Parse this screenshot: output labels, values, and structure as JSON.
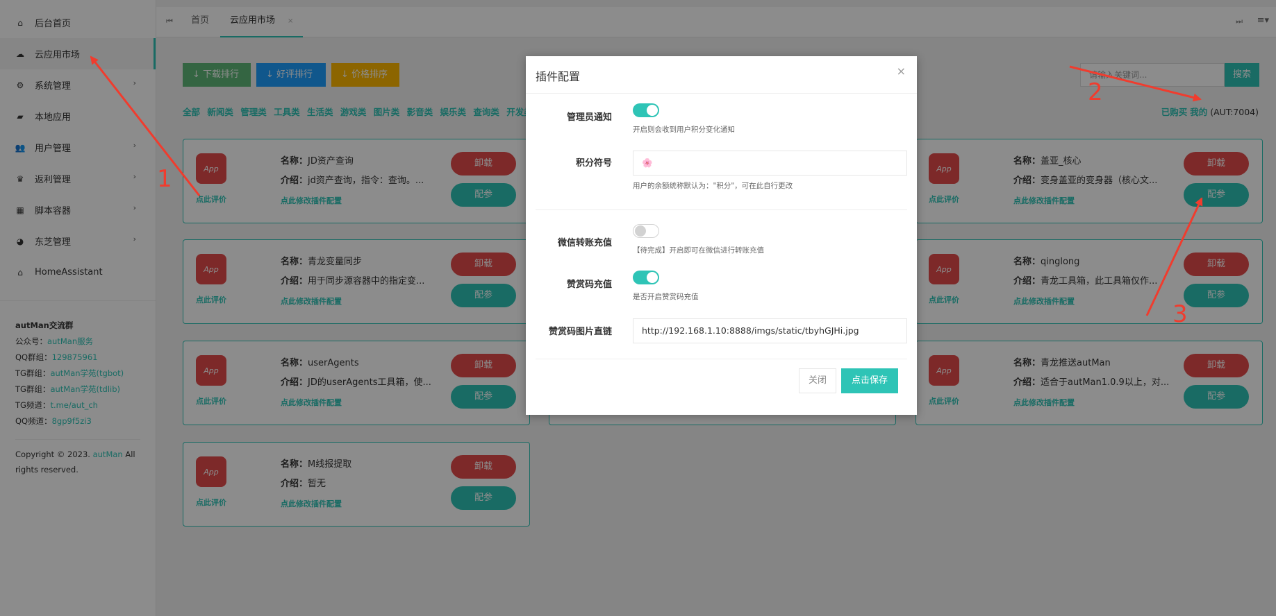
{
  "sidebar": {
    "items": [
      {
        "label": "后台首页",
        "icon": "home-icon",
        "active": false,
        "has_children": false
      },
      {
        "label": "云应用市场",
        "icon": "cloud-download-icon",
        "active": true,
        "has_children": false
      },
      {
        "label": "系统管理",
        "icon": "gear-icon",
        "active": false,
        "has_children": true
      },
      {
        "label": "本地应用",
        "icon": "cards-icon",
        "active": false,
        "has_children": false
      },
      {
        "label": "用户管理",
        "icon": "users-icon",
        "active": false,
        "has_children": true
      },
      {
        "label": "返利管理",
        "icon": "crown-icon",
        "active": false,
        "has_children": true
      },
      {
        "label": "脚本容器",
        "icon": "dashboard-icon",
        "active": false,
        "has_children": true
      },
      {
        "label": "东芝管理",
        "icon": "palette-icon",
        "active": false,
        "has_children": true
      },
      {
        "label": "HomeAssistant",
        "icon": "house-icon",
        "active": false,
        "has_children": false
      }
    ],
    "info": {
      "title": "autMan交流群",
      "rows": [
        {
          "key": "公众号：",
          "value": "autMan服务"
        },
        {
          "key": "QQ群组：",
          "value": "129875961"
        },
        {
          "key": "TG群组：",
          "value": "autMan学苑(tgbot)"
        },
        {
          "key": "TG群组：",
          "value": "autMan学苑(tdlib)"
        },
        {
          "key": "TG频道：",
          "value": "t.me/aut_ch"
        },
        {
          "key": "QQ频道：",
          "value": "8gp9f5zi3"
        }
      ]
    },
    "copyright_prefix": "Copyright © 2023. ",
    "copyright_link": "autMan",
    "copyright_suffix": " All rights reserved."
  },
  "topbar": {
    "tabs": [
      {
        "label": "首页"
      },
      {
        "label": "云应用市场",
        "close": "×"
      }
    ]
  },
  "toolbar": {
    "download_rank": "↓ 下载排行",
    "rating_rank": "↓ 好评排行",
    "price_sort": "↓ 价格排序",
    "search_placeholder": "请输入关键词...",
    "search_label": "搜索"
  },
  "categories": [
    "全部",
    "新闻类",
    "管理类",
    "工具类",
    "生活类",
    "游戏类",
    "图片类",
    "影音类",
    "娱乐类",
    "查询类",
    "开发类"
  ],
  "mine": {
    "bought": "已购买",
    "mine": "我的",
    "aut": "(AUT:7004)"
  },
  "cards": [
    {
      "name": "JD资产查询",
      "intro": "jd资产查询，指令：查询。...",
      "uninstall": "卸载",
      "config": "配参",
      "rate": "点此评价",
      "edit": "点此修改插件配置",
      "name_key": "名称：",
      "intro_key": "介绍："
    },
    {
      "name": "盖亚_核心",
      "intro": "变身盖亚的变身器（核心文...",
      "uninstall": "卸载",
      "config": "配参",
      "rate": "点此评价",
      "edit": "点此修改插件配置",
      "name_key": "名称：",
      "intro_key": "介绍："
    },
    {
      "name": "青龙变量同步",
      "intro": "用于同步源容器中的指定变...",
      "uninstall": "卸载",
      "config": "配参",
      "rate": "点此评价",
      "edit": "点此修改插件配置",
      "name_key": "名称：",
      "intro_key": "介绍："
    },
    {
      "name": "qinglong",
      "intro": "青龙工具箱，此工具箱仅作...",
      "uninstall": "卸载",
      "config": "配参",
      "rate": "点此评价",
      "edit": "点此修改插件配置",
      "name_key": "名称：",
      "intro_key": "介绍："
    },
    {
      "name": "userAgents",
      "intro": "JD的userAgents工具箱，使...",
      "uninstall": "卸载",
      "config": "配参",
      "rate": "点此评价",
      "edit": "点此修改插件配置",
      "name_key": "名称：",
      "intro_key": "介绍："
    },
    {
      "name": "青龙推送autMan",
      "intro": "适合于autMan1.0.9以上，对...",
      "uninstall": "卸载",
      "config": "配参",
      "rate": "点此评价",
      "edit": "点此修改插件配置",
      "name_key": "名称：",
      "intro_key": "介绍："
    },
    {
      "name": "M线报提取",
      "intro": "暂无",
      "uninstall": "卸载",
      "config": "配参",
      "rate": "点此评价",
      "edit": "点此修改插件配置",
      "name_key": "名称：",
      "intro_key": "介绍："
    }
  ],
  "modal": {
    "title": "插件配置",
    "close": "×",
    "admin_notify_label": "管理员通知",
    "admin_notify_on": true,
    "admin_notify_hint": "开启则会收到用户积分变化通知",
    "points_symbol_label": "积分符号",
    "points_symbol_value": "🌸",
    "points_symbol_hint": "用户的余额统称默认为：\"积分\"，可在此自行更改",
    "wechat_label": "微信转账充值",
    "wechat_on": false,
    "wechat_hint": "【待完成】开启即可在微信进行转账充值",
    "reward_label": "赞赏码充值",
    "reward_on": true,
    "reward_hint": "是否开启赞赏码充值",
    "reward_img_label": "赞赏码图片直链",
    "reward_img_value": "http://192.168.1.10:8888/imgs/static/tbyhGJHi.jpg",
    "btn_close": "关闭",
    "btn_save": "点击保存"
  },
  "annotations": [
    "1",
    "2",
    "3"
  ],
  "colors": {
    "accent": "#2ec4b6",
    "danger": "#e34b4b",
    "green": "#5fb878",
    "blue": "#1e9fff",
    "orange": "#ffb800",
    "arrow": "#f03c2e"
  }
}
